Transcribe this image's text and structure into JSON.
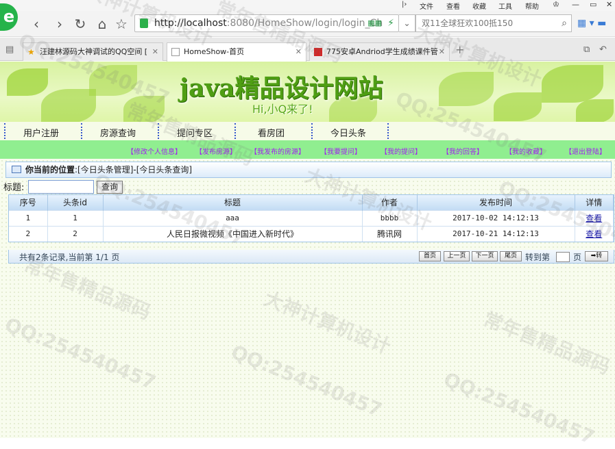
{
  "browser": {
    "menu": [
      "文件",
      "查看",
      "收藏",
      "工具",
      "帮助"
    ],
    "address_host": "http://localhost",
    "address_path": ":8080/HomeShow/login/login_Ch",
    "search_text": "双11全球狂欢100抵150",
    "tabs": [
      {
        "label": "汪建林源码大神调试的QQ空间 [",
        "active": false
      },
      {
        "label": "HomeShow-首页",
        "active": true
      },
      {
        "label": "775安卓Andriod学生成绩课件管",
        "active": false
      }
    ]
  },
  "banner": {
    "title": "java精品设计网站",
    "subtitle": "Hi,小Q来了!"
  },
  "main_nav": [
    "用户注册",
    "房源查询",
    "提问专区",
    "看房团",
    "今日头条"
  ],
  "sub_nav": [
    "【修改个人信息】",
    "【发布房源】",
    "【我发布的房源】",
    "【我要提问】",
    "【我的提问】",
    "【我的回答】",
    "【我的收藏】",
    "【退出登陆】"
  ],
  "breadcrumb": {
    "prefix": "你当前的位置",
    "path": ":[今日头条管理]-[今日头条查询]"
  },
  "search": {
    "label": "标题:",
    "value": "",
    "button": "查询"
  },
  "table": {
    "headers": [
      "序号",
      "头条id",
      "标题",
      "作者",
      "发布时间",
      "详情"
    ],
    "rows": [
      [
        "1",
        "1",
        "aaa",
        "bbbb",
        "2017-10-02 14:12:13",
        "查看"
      ],
      [
        "2",
        "2",
        "人民日报微视频《中国进入新时代》",
        "腾讯网",
        "2017-10-21 14:12:13",
        "查看"
      ]
    ]
  },
  "pager": {
    "summary": "共有2条记录,当前第 1/1 页",
    "first": "首页",
    "prev": "上一页",
    "next": "下一页",
    "last": "尾页",
    "goto_pre": "转到第",
    "goto_post": "页",
    "go": "➡转"
  },
  "watermarks": [
    "常年售精品源码",
    "大神计算机设计",
    "QQ:254540457"
  ]
}
